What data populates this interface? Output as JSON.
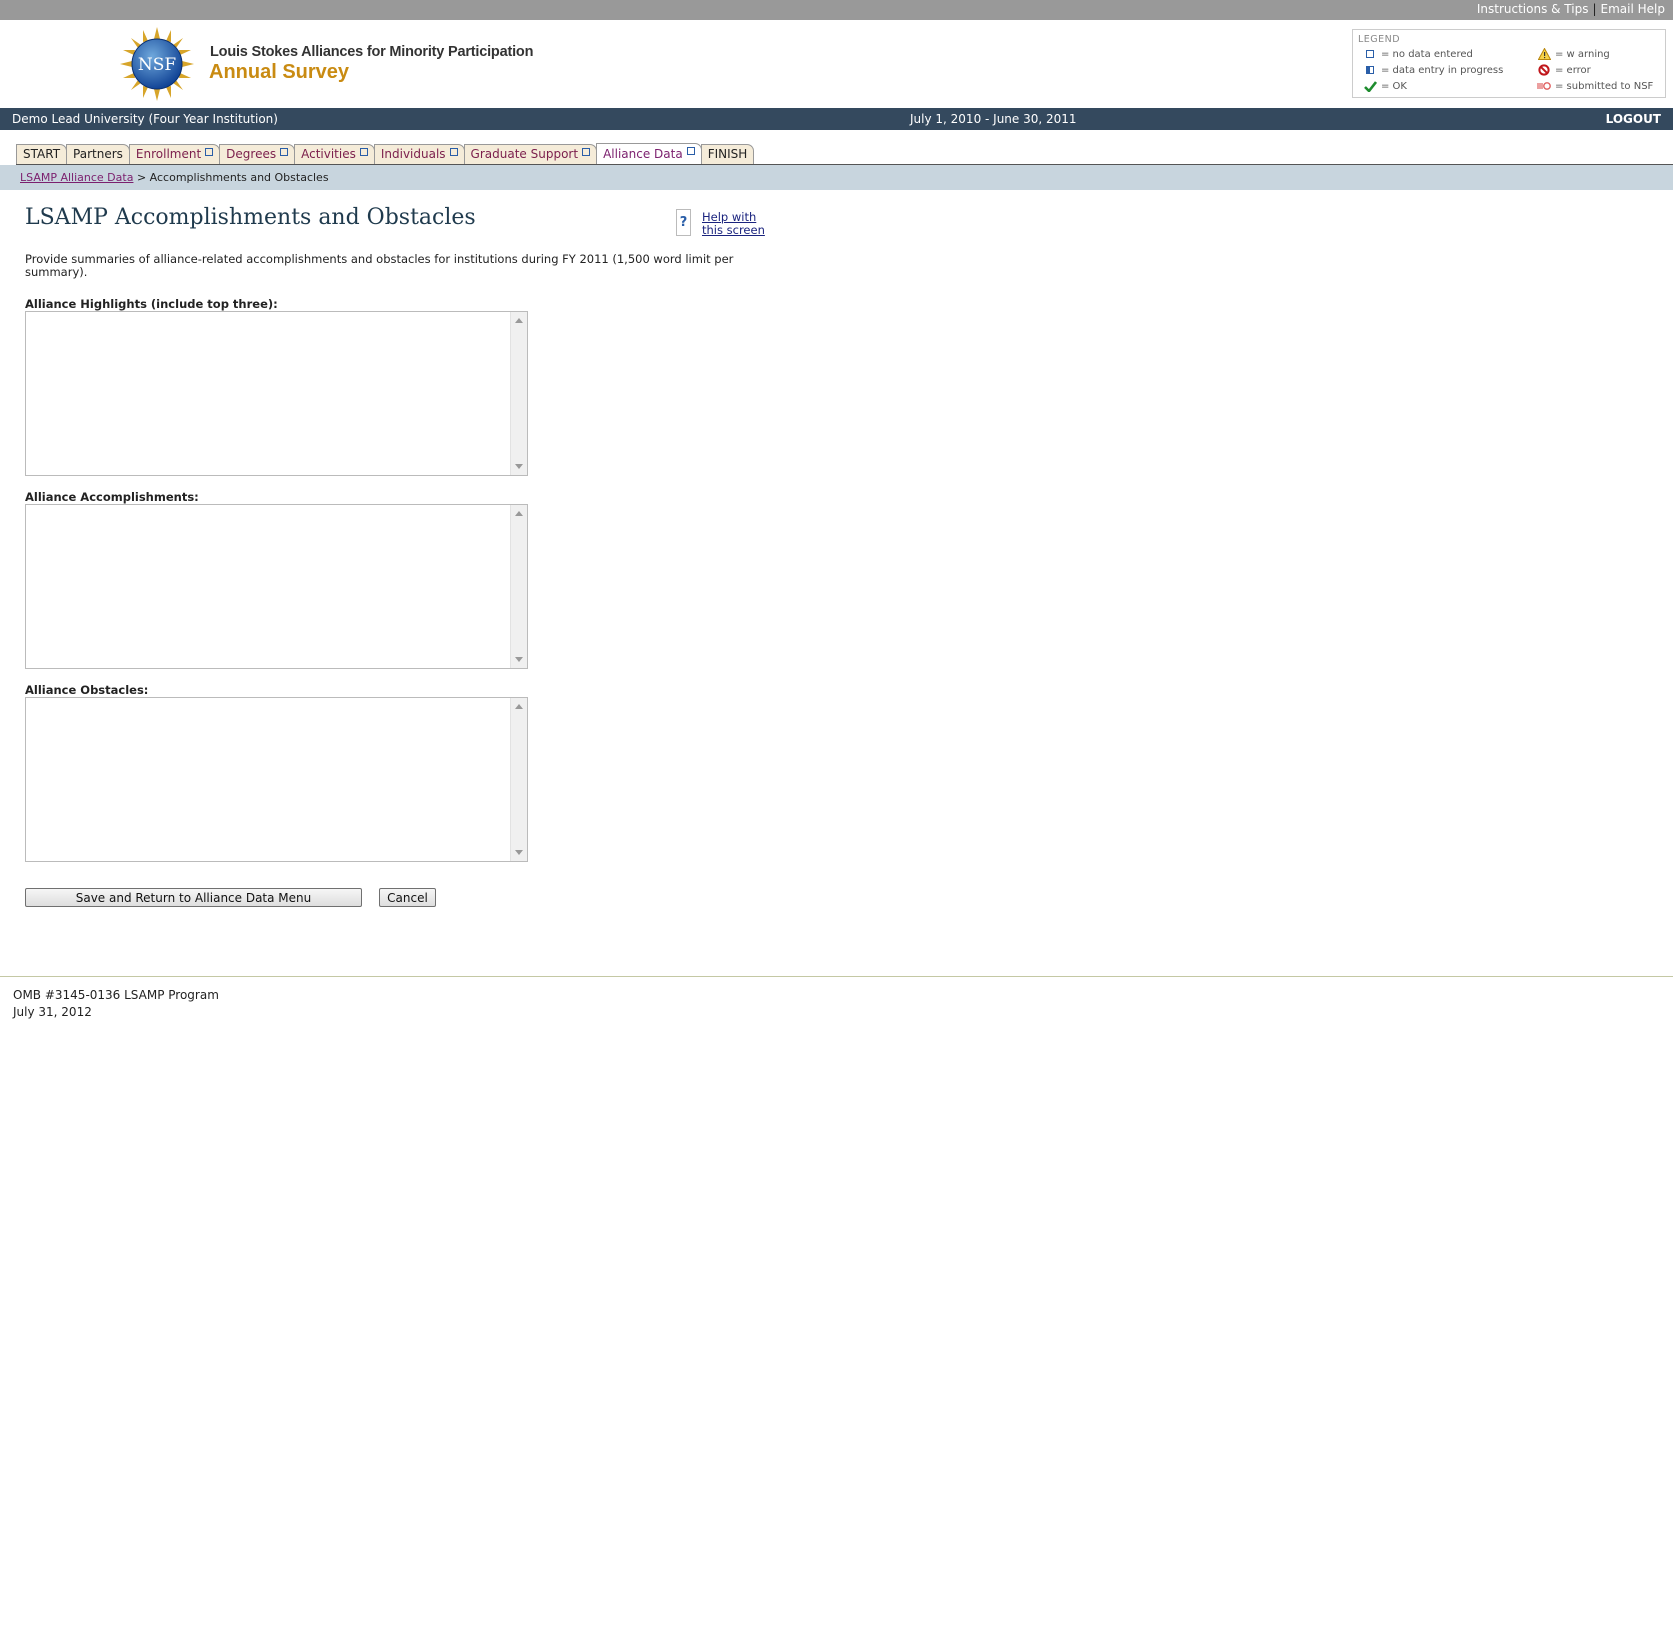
{
  "topbar": {
    "instructions_link": "Instructions & Tips",
    "separator": "|",
    "email_help_link": "Email Help"
  },
  "brand": {
    "seal_text": "NSF",
    "line1": "Louis Stokes Alliances for Minority Participation",
    "line2": "Annual Survey"
  },
  "legend": {
    "title": "LEGEND",
    "items": [
      {
        "icon": "empty-square-icon",
        "label": "= no data entered"
      },
      {
        "icon": "half-square-icon",
        "label": "= data entry in progress"
      },
      {
        "icon": "check-icon",
        "label": "= OK"
      },
      {
        "icon": "warning-icon",
        "label": "= w arning"
      },
      {
        "icon": "no-entry-icon",
        "label": "= error"
      },
      {
        "icon": "submitted-icon",
        "label": "= submitted to NSF"
      }
    ]
  },
  "infobar": {
    "institution": "Demo Lead University (Four Year Institution)",
    "period": "July 1, 2010 - June 30, 2011",
    "logout": "LOGOUT"
  },
  "tabs": [
    {
      "label": "START",
      "status": "none"
    },
    {
      "label": "Partners",
      "status": "none"
    },
    {
      "label": "Enrollment",
      "status": "no-data"
    },
    {
      "label": "Degrees",
      "status": "no-data"
    },
    {
      "label": "Activities",
      "status": "no-data"
    },
    {
      "label": "Individuals",
      "status": "no-data"
    },
    {
      "label": "Graduate Support",
      "status": "no-data"
    },
    {
      "label": "Alliance Data",
      "status": "no-data"
    },
    {
      "label": "FINISH",
      "status": "none"
    }
  ],
  "breadcrumb": {
    "parent": "LSAMP Alliance Data",
    "separator": ">",
    "current": "Accomplishments and Obstacles"
  },
  "page": {
    "title": "LSAMP Accomplishments and Obstacles",
    "help_icon": "?",
    "help_link": "Help with this screen",
    "intro": "Provide summaries of alliance-related accomplishments and obstacles for institutions during FY 2011 (1,500 word limit per summary)."
  },
  "fields": {
    "highlights_label": "Alliance Highlights (include top three):",
    "highlights_value": "",
    "accomplishments_label": "Alliance Accomplishments:",
    "accomplishments_value": "",
    "obstacles_label": "Alliance Obstacles:",
    "obstacles_value": ""
  },
  "buttons": {
    "save": "Save and Return to Alliance Data Menu",
    "cancel": "Cancel"
  },
  "footer": {
    "omb": "OMB #3145-0136 LSAMP Program",
    "date": "July 31, 2012"
  },
  "colors": {
    "brand_gold": "#c98b12",
    "header_navy": "#34495e",
    "tab_text": "#7b1f4c",
    "breadcrumb_bar": "#c8d5de"
  }
}
